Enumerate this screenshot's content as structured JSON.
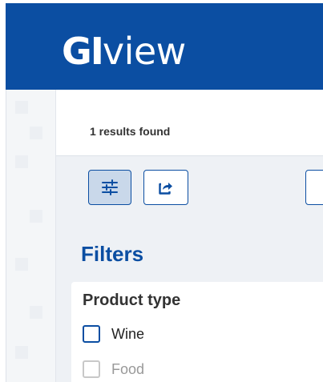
{
  "app": {
    "brand_strong": "GI",
    "brand_light": "view"
  },
  "results": {
    "summary": "1 results found"
  },
  "toolbar": {
    "filter_icon": "sliders-icon",
    "export_icon": "share-export-icon",
    "filter_active": true
  },
  "filters": {
    "title": "Filters",
    "groups": [
      {
        "title": "Product type",
        "options": [
          {
            "label": "Wine",
            "checked": false,
            "enabled": true
          },
          {
            "label": "Food",
            "checked": false,
            "enabled": false
          }
        ]
      }
    ]
  },
  "colors": {
    "brand": "#0b4ea2",
    "panel_bg": "#eef1f5",
    "active_button_bg": "#c9d8ea",
    "disabled_text": "#999999"
  }
}
